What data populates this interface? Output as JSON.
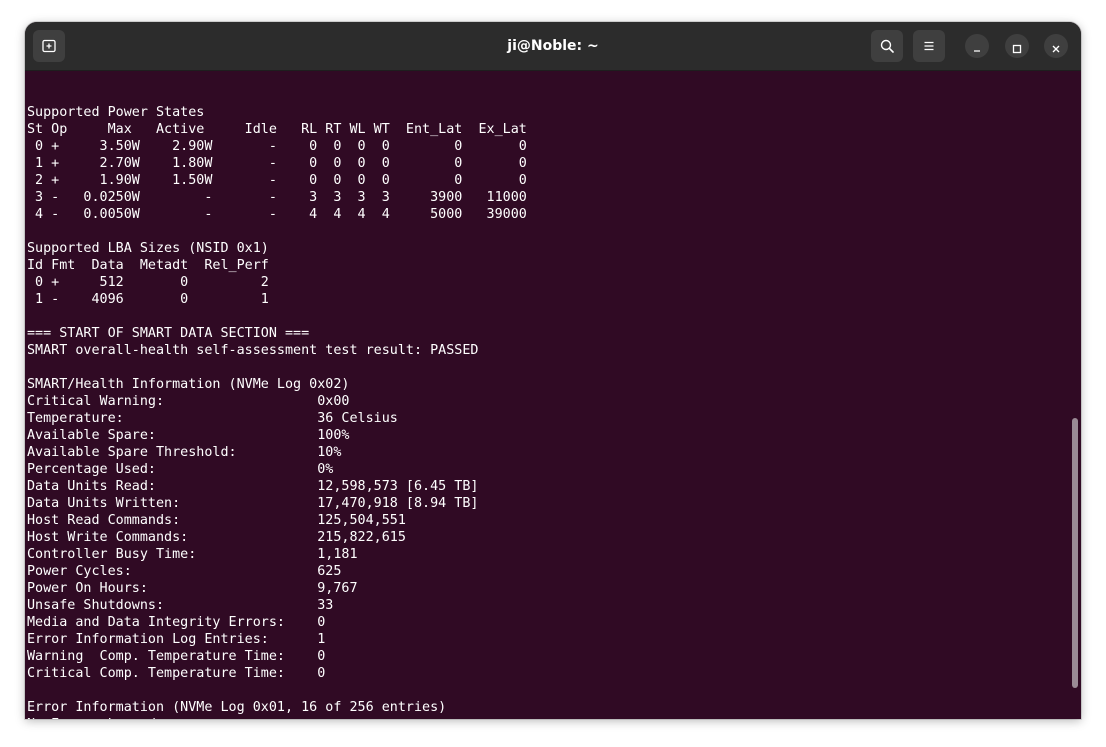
{
  "window": {
    "title": "ji@Noble: ~",
    "icons": {
      "new_tab": "new-tab-icon",
      "search": "search-icon",
      "menu": "hamburger-menu-icon",
      "minimize": "minimize-icon",
      "maximize": "maximize-icon",
      "close": "close-icon"
    },
    "colors": {
      "titlebar": "#2c2c2c",
      "terminal_bg": "#300a24",
      "text": "#ffffff"
    }
  },
  "terminal": {
    "lines": [
      "",
      "Supported Power States",
      "St Op     Max   Active     Idle   RL RT WL WT  Ent_Lat  Ex_Lat",
      " 0 +     3.50W    2.90W       -    0  0  0  0        0       0",
      " 1 +     2.70W    1.80W       -    0  0  0  0        0       0",
      " 2 +     1.90W    1.50W       -    0  0  0  0        0       0",
      " 3 -   0.0250W        -       -    3  3  3  3     3900   11000",
      " 4 -   0.0050W        -       -    4  4  4  4     5000   39000",
      "",
      "Supported LBA Sizes (NSID 0x1)",
      "Id Fmt  Data  Metadt  Rel_Perf",
      " 0 +     512       0         2",
      " 1 -    4096       0         1",
      "",
      "=== START OF SMART DATA SECTION ===",
      "SMART overall-health self-assessment test result: PASSED",
      "",
      "SMART/Health Information (NVMe Log 0x02)",
      "Critical Warning:                   0x00",
      "Temperature:                        36 Celsius",
      "Available Spare:                    100%",
      "Available Spare Threshold:          10%",
      "Percentage Used:                    0%",
      "Data Units Read:                    12,598,573 [6.45 TB]",
      "Data Units Written:                 17,470,918 [8.94 TB]",
      "Host Read Commands:                 125,504,551",
      "Host Write Commands:                215,822,615",
      "Controller Busy Time:               1,181",
      "Power Cycles:                       625",
      "Power On Hours:                     9,767",
      "Unsafe Shutdowns:                   33",
      "Media and Data Integrity Errors:    0",
      "Error Information Log Entries:      1",
      "Warning  Comp. Temperature Time:    0",
      "Critical Comp. Temperature Time:    0",
      "",
      "Error Information (NVMe Log 0x01, 16 of 256 entries)",
      "No Errors Logged"
    ]
  }
}
